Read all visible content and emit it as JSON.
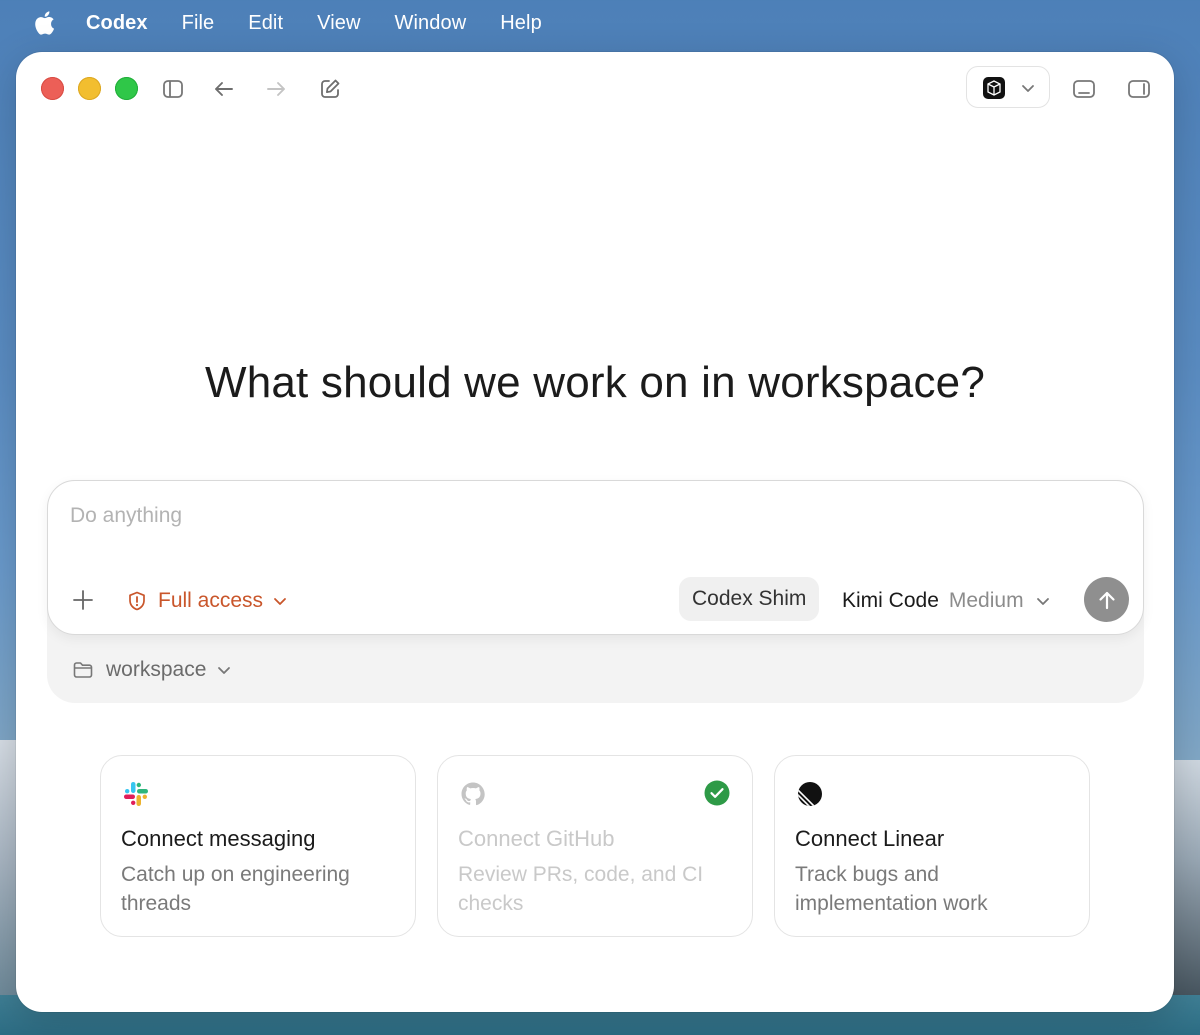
{
  "menubar": {
    "app_name": "Codex",
    "items": [
      "File",
      "Edit",
      "View",
      "Window",
      "Help"
    ]
  },
  "window": {
    "heading": "What should we work on in workspace?"
  },
  "composer": {
    "placeholder": "Do anything",
    "access_label": "Full access",
    "shim_label": "Codex Shim",
    "model_name": "Kimi Code",
    "model_effort": "Medium",
    "workspace_label": "workspace"
  },
  "cards": [
    {
      "title": "Connect messaging",
      "description": "Catch up on engineering threads",
      "icon": "slack-icon",
      "connected": false
    },
    {
      "title": "Connect GitHub",
      "description": "Review PRs, code, and CI checks",
      "icon": "github-icon",
      "connected": true
    },
    {
      "title": "Connect Linear",
      "description": "Track bugs and implementation work",
      "icon": "linear-icon",
      "connected": false
    }
  ],
  "colors": {
    "accent_warning": "#c9562b",
    "connected_green": "#2e9a47",
    "send_button": "#8f8f8f"
  }
}
